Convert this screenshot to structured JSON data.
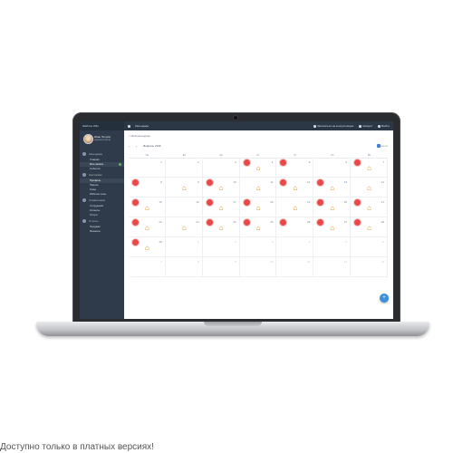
{
  "sidebar": {
    "brand": "Шаблон Wiki",
    "profile": {
      "name": "Иван Петров",
      "role": "Администратор"
    },
    "sections": [
      {
        "title": "Календарь",
        "items": [
          {
            "label": "Главная",
            "active": false,
            "badge": false
          },
          {
            "label": "Мои записи",
            "active": true,
            "badge": true
          },
          {
            "label": "События",
            "active": false,
            "badge": false
          }
        ]
      },
      {
        "title": "Настройки",
        "items": [
          {
            "label": "Профиль",
            "active": true,
            "badge": false
          },
          {
            "label": "Пароль",
            "active": false,
            "badge": false
          },
          {
            "label": "Темы",
            "active": false,
            "badge": false
          },
          {
            "label": "Рабочие часы",
            "active": false,
            "badge": false
          }
        ]
      },
      {
        "title": "Справочники",
        "items": [
          {
            "label": "Сотрудники",
            "active": false,
            "badge": false
          },
          {
            "label": "Клиенты",
            "active": false,
            "badge": false
          },
          {
            "label": "Услуги",
            "active": false,
            "badge": false
          }
        ]
      },
      {
        "title": "Отчеты",
        "items": [
          {
            "label": "Продажи",
            "active": false,
            "badge": false
          },
          {
            "label": "Финансы",
            "active": false,
            "badge": false
          }
        ]
      }
    ]
  },
  "topbar": {
    "title": "Календарь",
    "links": [
      "Записаться на консультацию",
      "Аккаунт",
      "Выйти"
    ]
  },
  "content": {
    "breadcrumb": "< Мой календарь",
    "month": "Февраль 2016",
    "checkbox_label": "Неделя",
    "weekdays": [
      "Пн",
      "Вт",
      "Ср",
      "Чт",
      "Пт",
      "Сб",
      "Вс"
    ]
  },
  "calendar": {
    "weeks": [
      [
        {
          "d": "1",
          "red": false,
          "house": false,
          "muted": false
        },
        {
          "d": "2",
          "red": false,
          "house": false,
          "muted": false
        },
        {
          "d": "3",
          "red": false,
          "house": false,
          "muted": false
        },
        {
          "d": "4",
          "red": true,
          "house": true,
          "muted": false
        },
        {
          "d": "5",
          "red": true,
          "house": false,
          "muted": false
        },
        {
          "d": "6",
          "red": false,
          "house": false,
          "muted": false
        },
        {
          "d": "7",
          "red": true,
          "house": true,
          "muted": false
        }
      ],
      [
        {
          "d": "8",
          "red": true,
          "house": false,
          "muted": false
        },
        {
          "d": "9",
          "red": false,
          "house": true,
          "muted": false
        },
        {
          "d": "10",
          "red": true,
          "house": true,
          "muted": false
        },
        {
          "d": "11",
          "red": false,
          "house": true,
          "muted": false
        },
        {
          "d": "12",
          "red": true,
          "house": true,
          "muted": false
        },
        {
          "d": "13",
          "red": true,
          "house": true,
          "muted": false
        },
        {
          "d": "14",
          "red": false,
          "house": true,
          "muted": false
        }
      ],
      [
        {
          "d": "15",
          "red": true,
          "house": true,
          "muted": false
        },
        {
          "d": "16",
          "red": false,
          "house": false,
          "muted": false
        },
        {
          "d": "17",
          "red": true,
          "house": true,
          "muted": false
        },
        {
          "d": "18",
          "red": true,
          "house": true,
          "muted": false
        },
        {
          "d": "19",
          "red": false,
          "house": true,
          "muted": false
        },
        {
          "d": "20",
          "red": true,
          "house": true,
          "muted": false
        },
        {
          "d": "21",
          "red": true,
          "house": true,
          "muted": false
        }
      ],
      [
        {
          "d": "22",
          "red": true,
          "house": true,
          "muted": false
        },
        {
          "d": "23",
          "red": false,
          "house": true,
          "muted": false
        },
        {
          "d": "24",
          "red": true,
          "house": true,
          "muted": false
        },
        {
          "d": "25",
          "red": true,
          "house": true,
          "muted": false
        },
        {
          "d": "26",
          "red": true,
          "house": false,
          "muted": false
        },
        {
          "d": "27",
          "red": true,
          "house": true,
          "muted": false
        },
        {
          "d": "28",
          "red": true,
          "house": true,
          "muted": false
        }
      ],
      [
        {
          "d": "29",
          "red": true,
          "house": true,
          "muted": false
        },
        {
          "d": "1",
          "red": false,
          "house": false,
          "muted": true
        },
        {
          "d": "2",
          "red": false,
          "house": false,
          "muted": true
        },
        {
          "d": "3",
          "red": false,
          "house": false,
          "muted": true
        },
        {
          "d": "4",
          "red": false,
          "house": false,
          "muted": true
        },
        {
          "d": "5",
          "red": false,
          "house": false,
          "muted": true
        },
        {
          "d": "6",
          "red": false,
          "house": false,
          "muted": true
        }
      ],
      [
        {
          "d": "7",
          "red": false,
          "house": false,
          "muted": true
        },
        {
          "d": "8",
          "red": false,
          "house": false,
          "muted": true
        },
        {
          "d": "9",
          "red": false,
          "house": false,
          "muted": true
        },
        {
          "d": "10",
          "red": false,
          "house": false,
          "muted": true
        },
        {
          "d": "11",
          "red": false,
          "house": false,
          "muted": true
        },
        {
          "d": "12",
          "red": false,
          "house": false,
          "muted": true
        },
        {
          "d": "13",
          "red": false,
          "house": false,
          "muted": true
        }
      ]
    ]
  },
  "icons": {
    "fab": "plus-icon",
    "cell_event": "house-icon",
    "cell_alert": "red-circle-badge"
  },
  "colors": {
    "sidebar_bg": "#2f3b4a",
    "accent": "#3c8fd8",
    "alert": "#e84a4a",
    "house": "#d48a19"
  },
  "caption": "Доступно только в платных версиях!"
}
